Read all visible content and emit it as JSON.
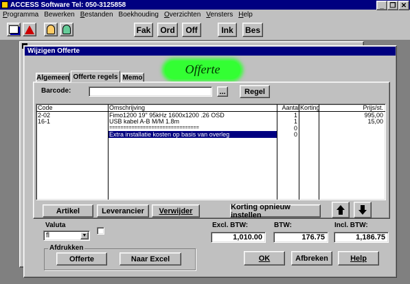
{
  "app": {
    "title": "ACCESS Software  Tel: 050-3125858",
    "title_icon": "access-key-icon"
  },
  "menu": [
    "Programma",
    "Bewerken",
    "Bestanden",
    "Boekhouding",
    "Overzichten",
    "Vensters",
    "Help"
  ],
  "toolbar": {
    "fak": "Fak",
    "ord": "Ord",
    "off": "Off",
    "ink": "Ink",
    "bes": "Bes"
  },
  "dialog": {
    "title": "Wijzigen Offerte",
    "heading": "Offerte",
    "tabs": [
      "Algemeen",
      "Offerte regels",
      "Memo"
    ],
    "barcode_label": "Barcode:",
    "barcode_value": "",
    "browse_label": "...",
    "regel_label": "Regel",
    "columns": [
      "Code",
      "Omschrijving",
      "Aantal",
      "Korting",
      "Prijs/st."
    ],
    "rows": [
      {
        "code": "2-02",
        "desc": "Fimo1200 19\" 95kHz 1600x1200 .26 OSD",
        "qty": "1",
        "disc": "",
        "price": "995,00"
      },
      {
        "code": "16-1",
        "desc": "USB kabel A-B M/M 1.8m",
        "qty": "1",
        "disc": "",
        "price": "15,00"
      },
      {
        "code": "",
        "desc": "================================",
        "qty": "0",
        "disc": "",
        "price": ""
      },
      {
        "code": "",
        "desc": "Extra installatie kosten op basis van overleg",
        "qty": "0",
        "disc": "",
        "price": ""
      }
    ],
    "buttons": {
      "artikel": "Artikel",
      "leverancier": "Leverancier",
      "verwijder": "Verwijder",
      "korting": "Korting opnieuw instellen",
      "offerte": "Offerte",
      "excel": "Naar Excel",
      "ok": "OK",
      "afbreken": "Afbreken",
      "help": "Help"
    },
    "valuta_label": "Valuta",
    "valuta_value": "fl",
    "afdrukken_label": "Afdrukken",
    "excl_label": "Excl. BTW:",
    "btw_label": "BTW:",
    "incl_label": "Incl. BTW:",
    "excl_value": "1,010.00",
    "btw_value": "176.75",
    "incl_value": "1,186.75"
  },
  "colors": {
    "titlebar": "#000080",
    "face": "#c0c0c0",
    "heading_green": "#33ff33",
    "selection": "#000080"
  }
}
